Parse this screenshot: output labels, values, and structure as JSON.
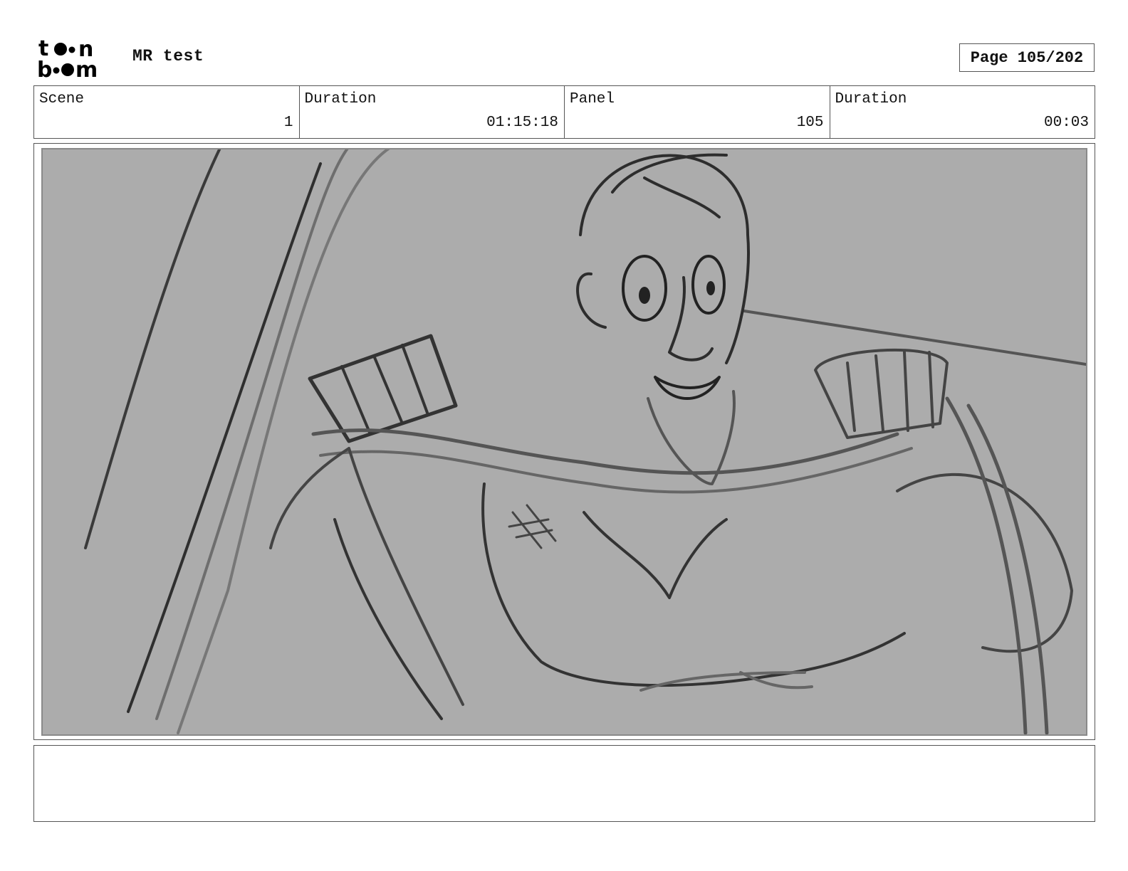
{
  "header": {
    "logo": {
      "line1": "toon",
      "line2": "boom",
      "icon": "toon-boom-logo"
    },
    "project_title": "MR test",
    "page_label": "Page 105/202"
  },
  "info": {
    "scene": {
      "label": "Scene",
      "value": "1"
    },
    "scene_duration": {
      "label": "Duration",
      "value": "01:15:18"
    },
    "panel": {
      "label": "Panel",
      "value": "105"
    },
    "panel_duration": {
      "label": "Duration",
      "value": "00:03"
    }
  },
  "panel": {
    "image_subject": "pencil-sketch-character-gripping-harness",
    "background_color": "#acacac"
  },
  "notes": {
    "text": ""
  }
}
